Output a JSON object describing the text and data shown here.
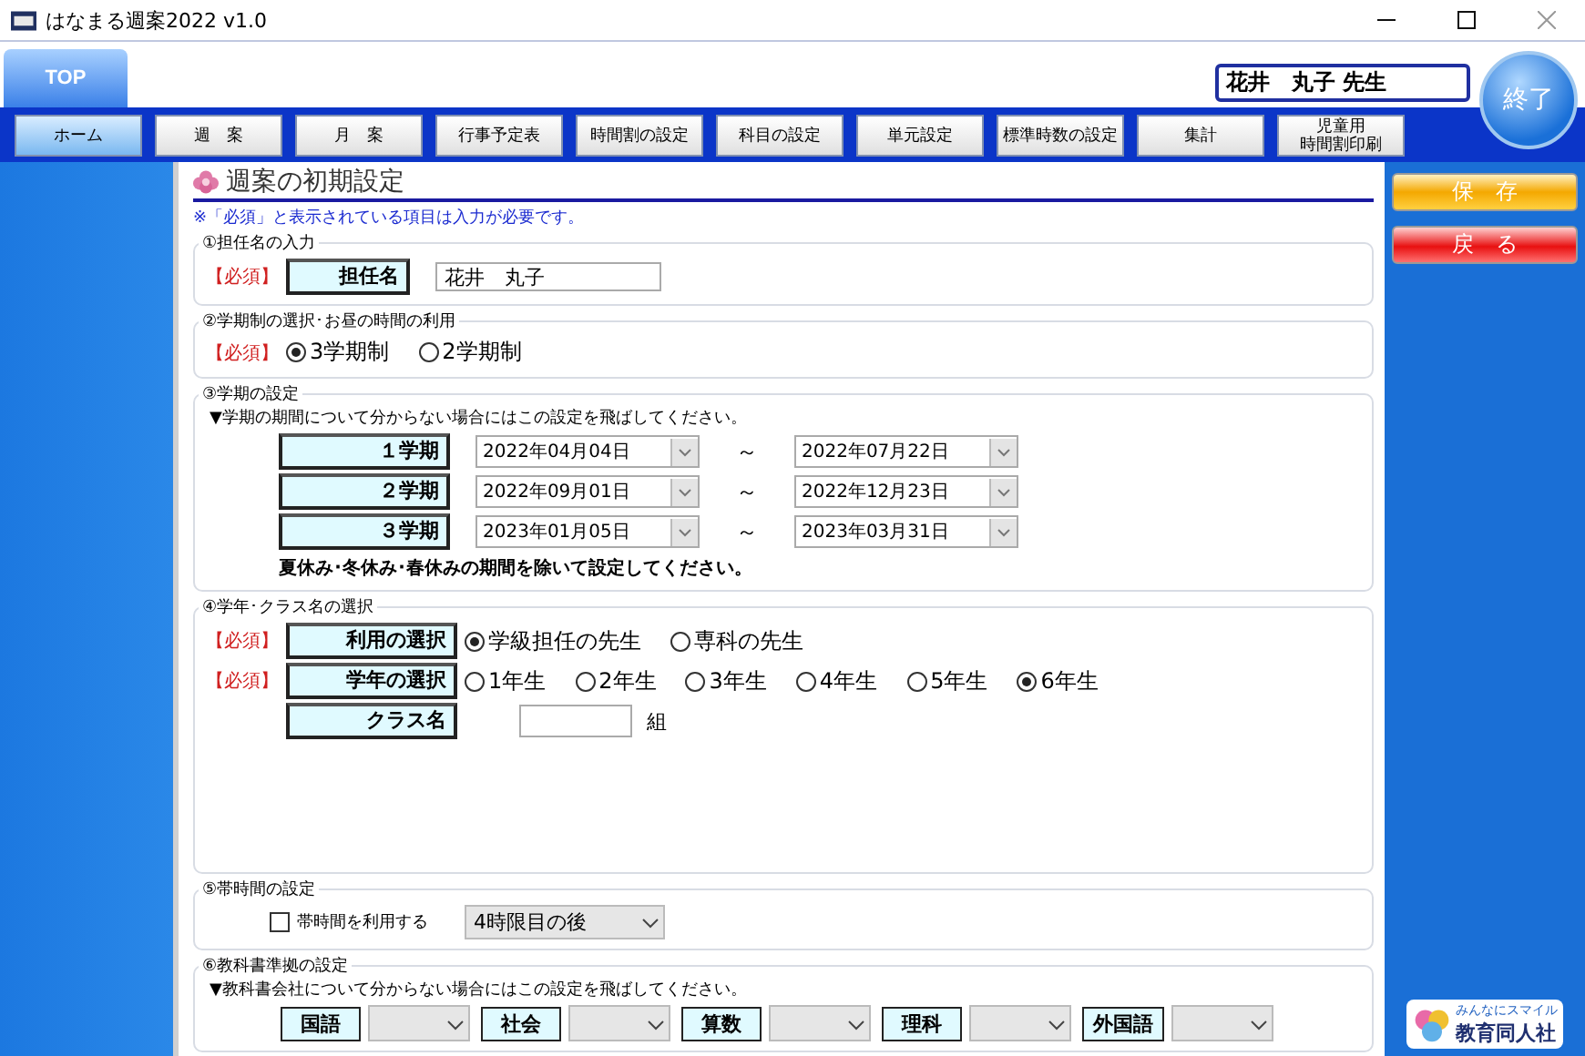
{
  "window": {
    "title": "はなまる週案2022 v1.0"
  },
  "top_tab": {
    "label": "TOP",
    "selected": true
  },
  "user_name": "花井　丸子 先生",
  "exit_button": "終了",
  "nav": [
    {
      "label": "ホーム",
      "selected": true
    },
    {
      "label": "週　案",
      "selected": false
    },
    {
      "label": "月　案",
      "selected": false
    },
    {
      "label": "行事予定表",
      "selected": false
    },
    {
      "label": "時間割の設定",
      "selected": false
    },
    {
      "label": "科目の設定",
      "selected": false
    },
    {
      "label": "単元設定",
      "selected": false
    },
    {
      "label": "標準時数の設定",
      "selected": false
    },
    {
      "label": "集計",
      "selected": false
    },
    {
      "label": "児童用",
      "label_line_2": "時間割印刷",
      "selected": false
    }
  ],
  "page_title": "週案の初期設定",
  "note": "※「必須」と表示されている項目は入力が必要です。",
  "teacher": {
    "legend": "①担任名の入力",
    "required": "【必須】",
    "label": "担任名",
    "value": "花井　丸子"
  },
  "term_system": {
    "legend": "②学期制の選択･お昼の時間の利用",
    "required": "【必須】",
    "options": [
      {
        "label": "3学期制",
        "selected": true
      },
      {
        "label": "2学期制",
        "selected": false
      }
    ]
  },
  "terms": {
    "legend": "③学期の設定",
    "hint": "▼学期の期間について分からない場合にはこの設定を飛ばしてください。",
    "rows": [
      {
        "label": "１学期",
        "start": "2022年04月04日",
        "sep": "～",
        "end": "2022年07月22日"
      },
      {
        "label": "２学期",
        "start": "2022年09月01日",
        "sep": "～",
        "end": "2022年12月23日"
      },
      {
        "label": "３学期",
        "start": "2023年01月05日",
        "sep": "～",
        "end": "2023年03月31日"
      }
    ],
    "footer": "夏休み･冬休み･春休みの期間を除いて設定してください。"
  },
  "grade_class": {
    "legend": "④学年･クラス名の選択",
    "rows": [
      {
        "required": "【必須】",
        "label": "利用の選択",
        "options": [
          {
            "label": "学級担任の先生",
            "selected": true
          },
          {
            "label": "専科の先生",
            "selected": false
          }
        ]
      },
      {
        "required": "【必須】",
        "label": "学年の選択",
        "options": [
          {
            "label": "1年生",
            "selected": false
          },
          {
            "label": "2年生",
            "selected": false
          },
          {
            "label": "3年生",
            "selected": false
          },
          {
            "label": "4年生",
            "selected": false
          },
          {
            "label": "5年生",
            "selected": false
          },
          {
            "label": "6年生",
            "selected": true
          }
        ]
      }
    ],
    "class_label": "クラス名",
    "class_suffix": "組"
  },
  "band_time": {
    "legend": "⑤帯時間の設定",
    "checkbox": {
      "label": "帯時間を利用する",
      "checked": false
    },
    "select": "4時限目の後"
  },
  "textbook": {
    "legend": "⑥教科書準拠の設定",
    "hint": "▼教科書会社について分からない場合にはこの設定を飛ばしてください。",
    "subjects": [
      "国語",
      "社会",
      "算数",
      "理科",
      "外国語"
    ]
  },
  "save_button": "保　存",
  "back_button": "戻　る",
  "logo": {
    "tagline": "みんなにスマイル",
    "name": "教育同人社"
  }
}
